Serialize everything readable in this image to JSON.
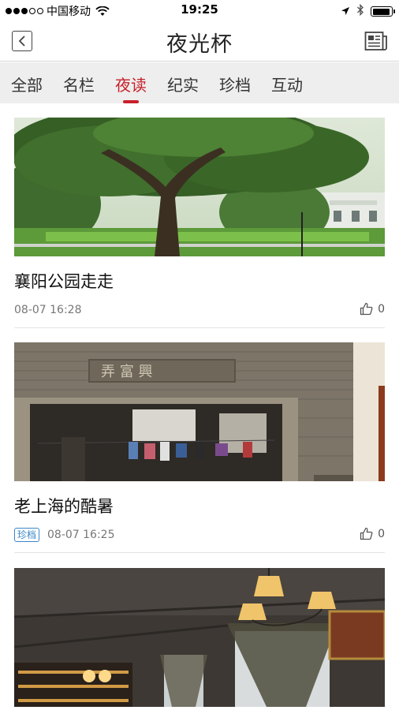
{
  "status_bar": {
    "carrier": "中国移动",
    "time": "19:25",
    "battery_level": 0.95
  },
  "nav": {
    "title": "夜光杯",
    "back_icon": "back-chevron-icon",
    "right_icon": "newspaper-icon"
  },
  "tabs": [
    {
      "label": "全部",
      "active": false
    },
    {
      "label": "名栏",
      "active": false
    },
    {
      "label": "夜读",
      "active": true
    },
    {
      "label": "纪实",
      "active": false
    },
    {
      "label": "珍档",
      "active": false
    },
    {
      "label": "互动",
      "active": false
    }
  ],
  "articles": [
    {
      "title": "襄阳公园走走",
      "tag": "",
      "time": "08-07 16:28",
      "likes": "0",
      "image": "park-tree-photo"
    },
    {
      "title": "老上海的酷暑",
      "tag": "珍档",
      "time": "08-07 16:25",
      "likes": "0",
      "image": "old-alley-gate-photo"
    },
    {
      "title": "",
      "tag": "",
      "time": "",
      "likes": "",
      "image": "cafe-lamps-photo"
    }
  ],
  "colors": {
    "accent": "#c8202a",
    "tag": "#3a86c8",
    "tab_bg": "#eeeeee"
  }
}
